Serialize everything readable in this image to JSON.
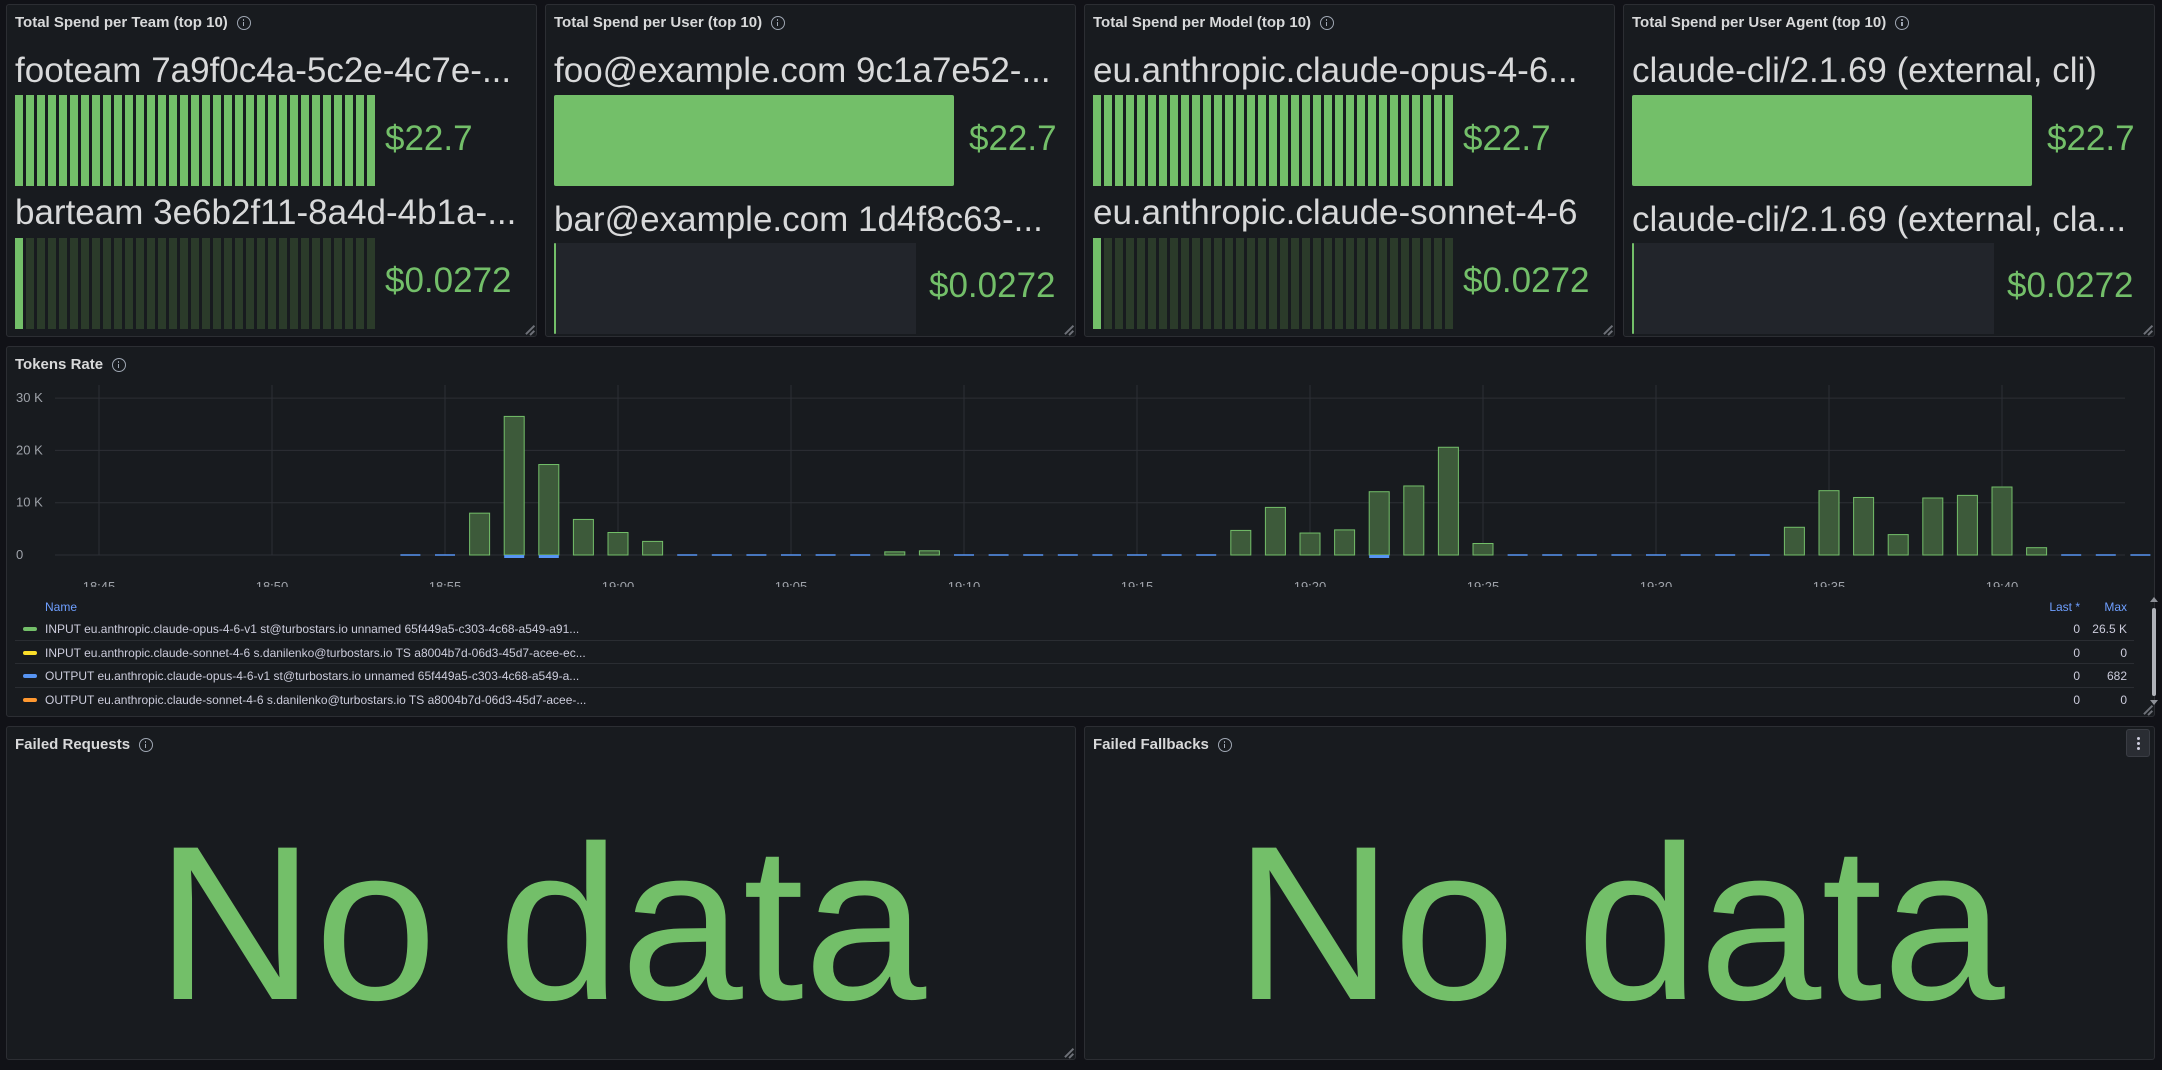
{
  "colors": {
    "green": "#73bf69",
    "yellow": "#fade2a",
    "blue": "#5794f2",
    "orange": "#ff9830"
  },
  "panels": {
    "team": {
      "title": "Total Spend per Team (top 10)",
      "style": "lcd",
      "rows": [
        {
          "label": "footeam 7a9f0c4a-5c2e-4c7e-...",
          "value": "$22.7",
          "fill": 1.0
        },
        {
          "label": "barteam 3e6b2f11-8a4d-4b1a-...",
          "value": "$0.0272",
          "fill": 0.0012
        }
      ]
    },
    "user": {
      "title": "Total Spend per User (top 10)",
      "style": "basic",
      "rows": [
        {
          "label": "foo@example.com 9c1a7e52-...",
          "value": "$22.7",
          "fill": 1.0
        },
        {
          "label": "bar@example.com 1d4f8c63-...",
          "value": "$0.0272",
          "fill": 0.0012
        }
      ]
    },
    "model": {
      "title": "Total Spend per Model (top 10)",
      "style": "lcd",
      "rows": [
        {
          "label": "eu.anthropic.claude-opus-4-6...",
          "value": "$22.7",
          "fill": 1.0
        },
        {
          "label": "eu.anthropic.claude-sonnet-4-6",
          "value": "$0.0272",
          "fill": 0.0012
        }
      ]
    },
    "agent": {
      "title": "Total Spend per User Agent (top 10)",
      "style": "basic",
      "rows": [
        {
          "label": "claude-cli/2.1.69 (external, cli)",
          "value": "$22.7",
          "fill": 1.0
        },
        {
          "label": "claude-cli/2.1.69 (external, cla...",
          "value": "$0.0272",
          "fill": 0.0012
        }
      ]
    },
    "tokens": {
      "title": "Tokens Rate"
    },
    "failed_requests": {
      "title": "Failed Requests",
      "message": "No data"
    },
    "failed_fallbacks": {
      "title": "Failed Fallbacks",
      "message": "No data"
    }
  },
  "legend": {
    "headers": {
      "name": "Name",
      "last": "Last *",
      "max": "Max"
    },
    "rows": [
      {
        "name": "INPUT eu.anthropic.claude-opus-4-6-v1 st@turbostars.io unnamed 65f449a5-c303-4c68-a549-a91...",
        "last": "0",
        "max": "26.5 K",
        "color": "#73bf69"
      },
      {
        "name": "INPUT eu.anthropic.claude-sonnet-4-6 s.danilenko@turbostars.io TS a8004b7d-06d3-45d7-acee-ec...",
        "last": "0",
        "max": "0",
        "color": "#fade2a"
      },
      {
        "name": "OUTPUT eu.anthropic.claude-opus-4-6-v1 st@turbostars.io unnamed 65f449a5-c303-4c68-a549-a...",
        "last": "0",
        "max": "682",
        "color": "#5794f2"
      },
      {
        "name": "OUTPUT eu.anthropic.claude-sonnet-4-6 s.danilenko@turbostars.io TS a8004b7d-06d3-45d7-acee-...",
        "last": "0",
        "max": "0",
        "color": "#ff9830"
      }
    ]
  },
  "chart_data": {
    "type": "bar",
    "x_ticks": [
      "18:45",
      "18:50",
      "18:55",
      "19:00",
      "19:05",
      "19:10",
      "19:15",
      "19:20",
      "19:25",
      "19:30",
      "19:35",
      "19:40"
    ],
    "y_ticks": [
      "0",
      "10 K",
      "20 K",
      "30 K"
    ],
    "ylim": [
      0,
      30000
    ],
    "x_unit": "minutes after 18:45",
    "series": [
      {
        "name": "INPUT eu.anthropic.claude-opus-4-6-v1 st@turbostars.io unnamed 65f449a5-c303-4c68-a549-a91...",
        "color": "#73bf69",
        "points": [
          [
            9,
            0
          ],
          [
            10,
            0
          ],
          [
            11,
            8000
          ],
          [
            12,
            26500
          ],
          [
            13,
            17300
          ],
          [
            14,
            6800
          ],
          [
            15,
            4300
          ],
          [
            16,
            2600
          ],
          [
            17,
            0
          ],
          [
            18,
            0
          ],
          [
            19,
            0
          ],
          [
            20,
            0
          ],
          [
            21,
            0
          ],
          [
            22,
            0
          ],
          [
            23,
            600
          ],
          [
            24,
            800
          ],
          [
            25,
            0
          ],
          [
            26,
            0
          ],
          [
            27,
            0
          ],
          [
            28,
            0
          ],
          [
            29,
            0
          ],
          [
            30,
            0
          ],
          [
            31,
            0
          ],
          [
            32,
            0
          ],
          [
            33,
            4700
          ],
          [
            34,
            9100
          ],
          [
            35,
            4200
          ],
          [
            36,
            4800
          ],
          [
            37,
            12100
          ],
          [
            38,
            13200
          ],
          [
            39,
            20600
          ],
          [
            40,
            2200
          ],
          [
            41,
            0
          ],
          [
            42,
            0
          ],
          [
            43,
            0
          ],
          [
            44,
            0
          ],
          [
            45,
            0
          ],
          [
            46,
            0
          ],
          [
            47,
            0
          ],
          [
            48,
            0
          ],
          [
            49,
            5300
          ],
          [
            50,
            12300
          ],
          [
            51,
            11000
          ],
          [
            52,
            3900
          ],
          [
            53,
            10900
          ],
          [
            54,
            11400
          ],
          [
            55,
            13000
          ],
          [
            56,
            1400
          ],
          [
            57,
            0
          ],
          [
            58,
            0
          ],
          [
            59,
            0
          ]
        ]
      },
      {
        "name": "OUTPUT eu.anthropic.claude-opus-4-6-v1 st@turbostars.io unnamed 65f449a5-c303-4c68-a549-a...",
        "color": "#5794f2",
        "points": [
          [
            12,
            350
          ],
          [
            13,
            682
          ],
          [
            37,
            500
          ]
        ]
      }
    ]
  }
}
